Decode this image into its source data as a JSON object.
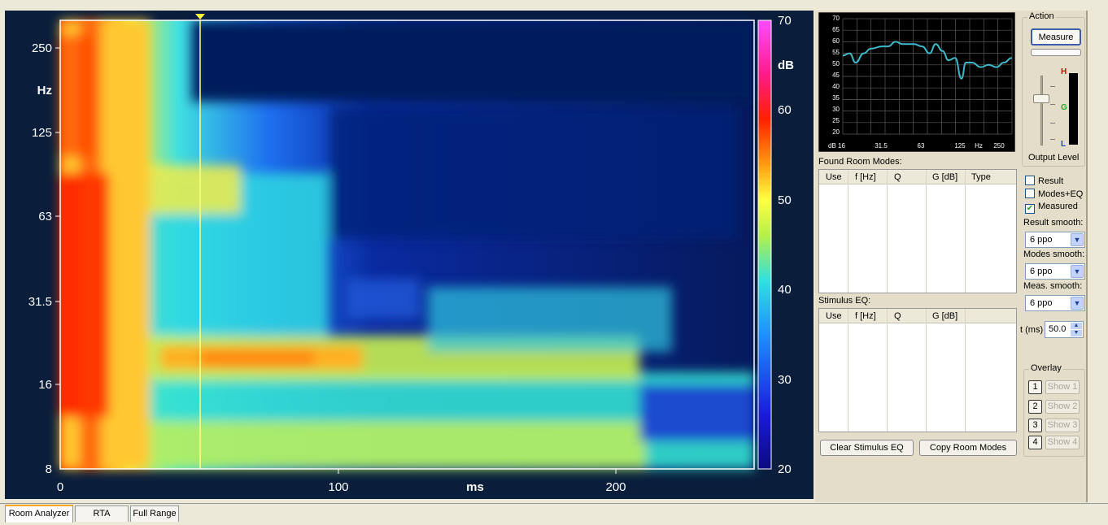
{
  "waterfall": {
    "y_axis": {
      "unit": "Hz",
      "ticks": [
        "250",
        "125",
        "63",
        "31.5",
        "16",
        "8"
      ]
    },
    "x_axis": {
      "unit": "ms",
      "ticks": [
        "0",
        "100",
        "200"
      ]
    },
    "colorbar": {
      "unit": "dB",
      "ticks": [
        "70",
        "60",
        "50",
        "40",
        "30",
        "20"
      ]
    },
    "cursor_ms": 50
  },
  "spl_graph": {
    "y_ticks": [
      "70",
      "65",
      "60",
      "55",
      "50",
      "45",
      "40",
      "35",
      "30",
      "25",
      "20"
    ],
    "x_ticks": [
      "dB 16",
      "31.5",
      "63",
      "125",
      "Hz",
      "250"
    ],
    "curve": [
      {
        "hz": 16,
        "db": 54
      },
      {
        "hz": 18,
        "db": 55
      },
      {
        "hz": 20,
        "db": 51
      },
      {
        "hz": 23,
        "db": 55
      },
      {
        "hz": 26,
        "db": 57
      },
      {
        "hz": 31.5,
        "db": 58
      },
      {
        "hz": 35,
        "db": 58
      },
      {
        "hz": 40,
        "db": 60
      },
      {
        "hz": 45,
        "db": 59
      },
      {
        "hz": 55,
        "db": 59
      },
      {
        "hz": 63,
        "db": 58
      },
      {
        "hz": 72,
        "db": 55
      },
      {
        "hz": 80,
        "db": 59
      },
      {
        "hz": 90,
        "db": 56
      },
      {
        "hz": 100,
        "db": 52
      },
      {
        "hz": 112,
        "db": 53
      },
      {
        "hz": 125,
        "db": 44
      },
      {
        "hz": 135,
        "db": 51
      },
      {
        "hz": 150,
        "db": 51
      },
      {
        "hz": 175,
        "db": 49
      },
      {
        "hz": 200,
        "db": 50
      },
      {
        "hz": 230,
        "db": 49
      },
      {
        "hz": 260,
        "db": 51
      },
      {
        "hz": 300,
        "db": 53
      }
    ],
    "line_color": "#3fb9c9"
  },
  "found_room_modes": {
    "title": "Found Room Modes:",
    "columns": [
      "Use",
      "f [Hz]",
      "Q",
      "G [dB]",
      "Type"
    ]
  },
  "stimulus_eq": {
    "title": "Stimulus EQ:",
    "columns": [
      "Use",
      "f [Hz]",
      "Q",
      "G [dB]"
    ]
  },
  "buttons": {
    "clear_stimulus": "Clear Stimulus EQ",
    "copy_modes": "Copy Room Modes"
  },
  "action": {
    "title": "Action",
    "measure": "Measure",
    "output_level": "Output Level",
    "meter_labels": [
      "H",
      "G",
      "L"
    ],
    "meter_colors": [
      "#d40000",
      "#2aa52a",
      "#1e3fc8"
    ]
  },
  "display": {
    "checkboxes": [
      {
        "label": "Result",
        "checked": false
      },
      {
        "label": "Modes+EQ",
        "checked": false
      },
      {
        "label": "Measured",
        "checked": true
      }
    ],
    "result_smooth_label": "Result smooth:",
    "result_smooth": "6 ppo",
    "modes_smooth_label": "Modes smooth:",
    "modes_smooth": "6 ppo",
    "meas_smooth_label": "Meas. smooth:",
    "meas_smooth": "6 ppo",
    "t_label": "t (ms)",
    "t_value": "50.0"
  },
  "overlay": {
    "title": "Overlay",
    "items": [
      {
        "num": "1",
        "label": "Show 1"
      },
      {
        "num": "2",
        "label": "Show 2"
      },
      {
        "num": "3",
        "label": "Show 3"
      },
      {
        "num": "4",
        "label": "Show 4"
      }
    ]
  },
  "tabs": [
    "Room Analyzer",
    "RTA",
    "Full Range"
  ]
}
